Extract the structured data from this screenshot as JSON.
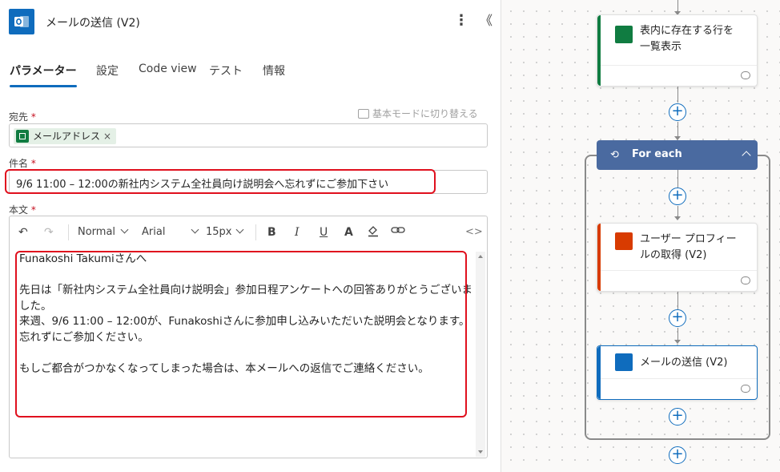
{
  "header": {
    "title": "メールの送信 (V2)",
    "more_icon": "⋮",
    "collapse_icon": "《"
  },
  "tabs": [
    {
      "label": "パラメーター",
      "active": true
    },
    {
      "label": "設定"
    },
    {
      "label": "Code view"
    },
    {
      "label": "テスト"
    },
    {
      "label": "情報"
    }
  ],
  "form": {
    "to_label": "宛先",
    "switch_mode_label": "基本モードに切り替える",
    "to_token": "メールアドレス",
    "to_token_remove": "×",
    "subject_label": "件名",
    "subject_value": "9/6 11:00 – 12:00の新社内システム全社員向け説明会へ忘れずにご参加下さい",
    "body_label": "本文",
    "required_mark": "*"
  },
  "toolbar": {
    "undo_icon": "↶",
    "redo_icon": "↷",
    "format": "Normal",
    "font": "Arial",
    "size": "15px",
    "bold": "B",
    "italic": "I",
    "underline": "U",
    "text_color": "A",
    "code_view": "<>"
  },
  "body_lines": [
    "Funakoshi Takumiさんへ",
    "",
    "先日は「新社内システム全社員向け説明会」参加日程アンケートへの回答ありがとうございました。",
    "来週、9/6 11:00 – 12:00が、Funakoshiさんに参加申し込みいただいた説明会となります。",
    "忘れずにご参加ください。",
    "",
    "もしご都合がつかなくなってしまった場合は、本メールへの返信でご連絡ください。"
  ],
  "flow": {
    "card1_title_1": "表内に存在する行を",
    "card1_title_2": "一覧表示",
    "loop_title": "For each",
    "card2_title_1": "ユーザー プロフィー",
    "card2_title_2": "ルの取得 (V2)",
    "card3_title": "メールの送信 (V2)",
    "plus_icon": "+",
    "colors": {
      "excel": "#107c41",
      "office": "#d83b01",
      "outlook": "#0f6cbd",
      "loop": "#4a6aa0"
    }
  }
}
